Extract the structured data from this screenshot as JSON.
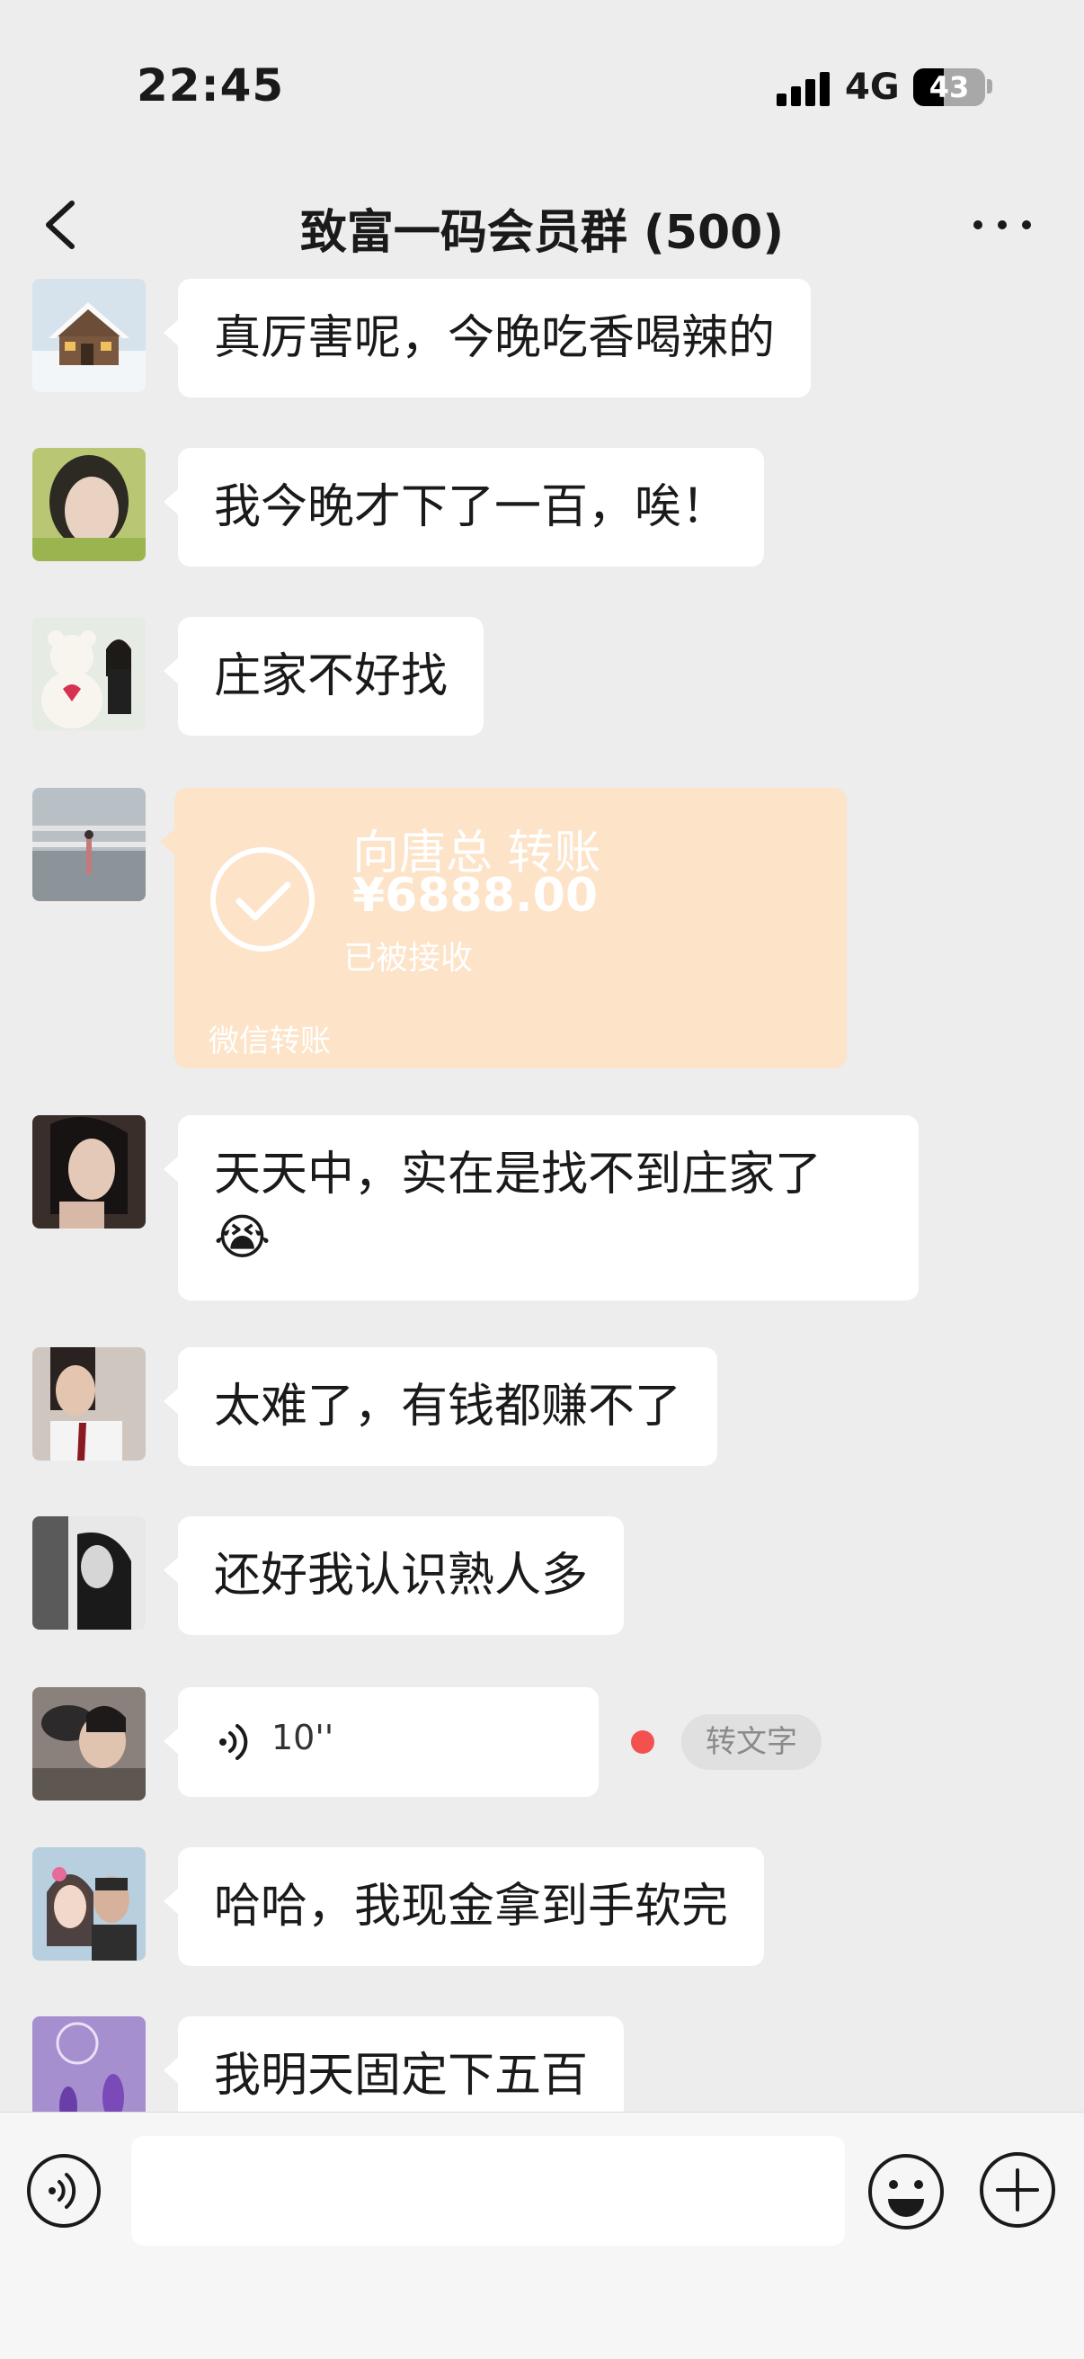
{
  "status_bar": {
    "time": "22:45",
    "network": "4G",
    "battery": "43",
    "battery_level": 0.43
  },
  "header": {
    "title": "致富一码会员群 (500)"
  },
  "messages": [
    {
      "type": "text",
      "text": "真厉害呢，今晚吃香喝辣的",
      "avatar": "cabin-snow"
    },
    {
      "type": "text",
      "text": "我今晚才下了一百，唉！",
      "avatar": "girl-portrait"
    },
    {
      "type": "text",
      "text": "庄家不好找",
      "avatar": "teddy-bear-couple"
    },
    {
      "type": "transfer",
      "title": "向唐总 转账",
      "amount": "¥6888.00",
      "status": "已被接收",
      "label": "微信转账",
      "avatar": "airport-photo"
    },
    {
      "type": "text",
      "text": "天天中，实在是找不到庄家了",
      "emoji": "😭",
      "avatar": "woman-dark"
    },
    {
      "type": "text",
      "text": "太难了，有钱都赚不了",
      "avatar": "man-suit"
    },
    {
      "type": "text",
      "text": "还好我认识熟人多",
      "avatar": "bw-woman"
    },
    {
      "type": "voice",
      "duration": "10''",
      "convert_label": "转文字",
      "avatar": "couple-cat"
    },
    {
      "type": "text",
      "text": "哈哈，我现金拿到手软完",
      "avatar": "couple-selfie"
    },
    {
      "type": "text",
      "text": "我明天固定下五百",
      "avatar": "lavender"
    }
  ],
  "input_bar": {
    "placeholder": ""
  },
  "colors": {
    "background": "#ededed",
    "bubble": "#ffffff",
    "transfer": "#fde3c8",
    "unread": "#f25150"
  }
}
